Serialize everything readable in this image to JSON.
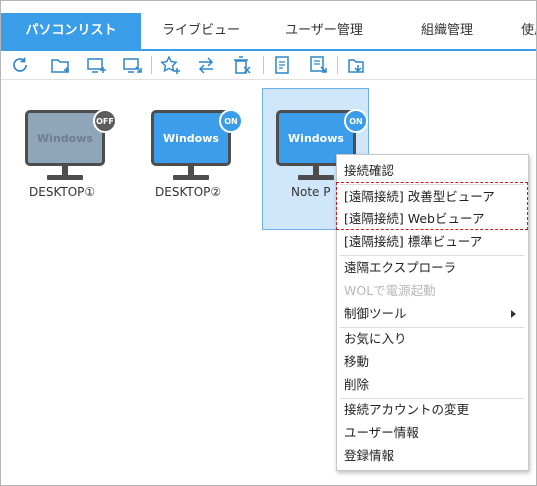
{
  "tabs": [
    {
      "label": "パソコンリスト",
      "active": true
    },
    {
      "label": "ライブビュー"
    },
    {
      "label": "ユーザー管理"
    },
    {
      "label": "組織管理"
    },
    {
      "label": "使用"
    }
  ],
  "toolbar": {
    "icons": [
      "refresh-icon",
      "add-folder-icon",
      "add-pc-icon",
      "move-pc-icon",
      "favorite-add-icon",
      "transfer-icon",
      "delete-icon",
      "document-icon",
      "export-icon",
      "import-icon"
    ],
    "color": "#2f86c9"
  },
  "devices": [
    {
      "name": "DESKTOP①",
      "os_label": "Windows",
      "status": "OFF",
      "selected": false
    },
    {
      "name": "DESKTOP②",
      "os_label": "Windows",
      "status": "ON",
      "selected": false
    },
    {
      "name": "Note P",
      "os_label": "Windows",
      "status": "ON",
      "selected": true
    }
  ],
  "colors": {
    "accent": "#3a9de8",
    "screen_on": "#3c9eea",
    "screen_off": "#8fa5b8",
    "frame": "#4d4d4d",
    "badge_off": "#5c5c5c",
    "highlight_border": "#c81e1e"
  },
  "context_menu": {
    "items": [
      {
        "label": "接続確認"
      },
      {
        "label": "[遠隔接続] 改善型ビューア"
      },
      {
        "label": "[遠隔接続] Webビューア"
      },
      {
        "label": "[遠隔接続] 標準ビューア"
      },
      {
        "label": "遠隔エクスプローラ"
      },
      {
        "label": "WOLで電源起動",
        "disabled": true
      },
      {
        "label": "制御ツール",
        "submenu": true
      },
      {
        "label": "お気に入り"
      },
      {
        "label": "移動"
      },
      {
        "label": "削除"
      },
      {
        "label": "接続アカウントの変更"
      },
      {
        "label": "ユーザー情報"
      },
      {
        "label": "登録情報"
      }
    ]
  }
}
